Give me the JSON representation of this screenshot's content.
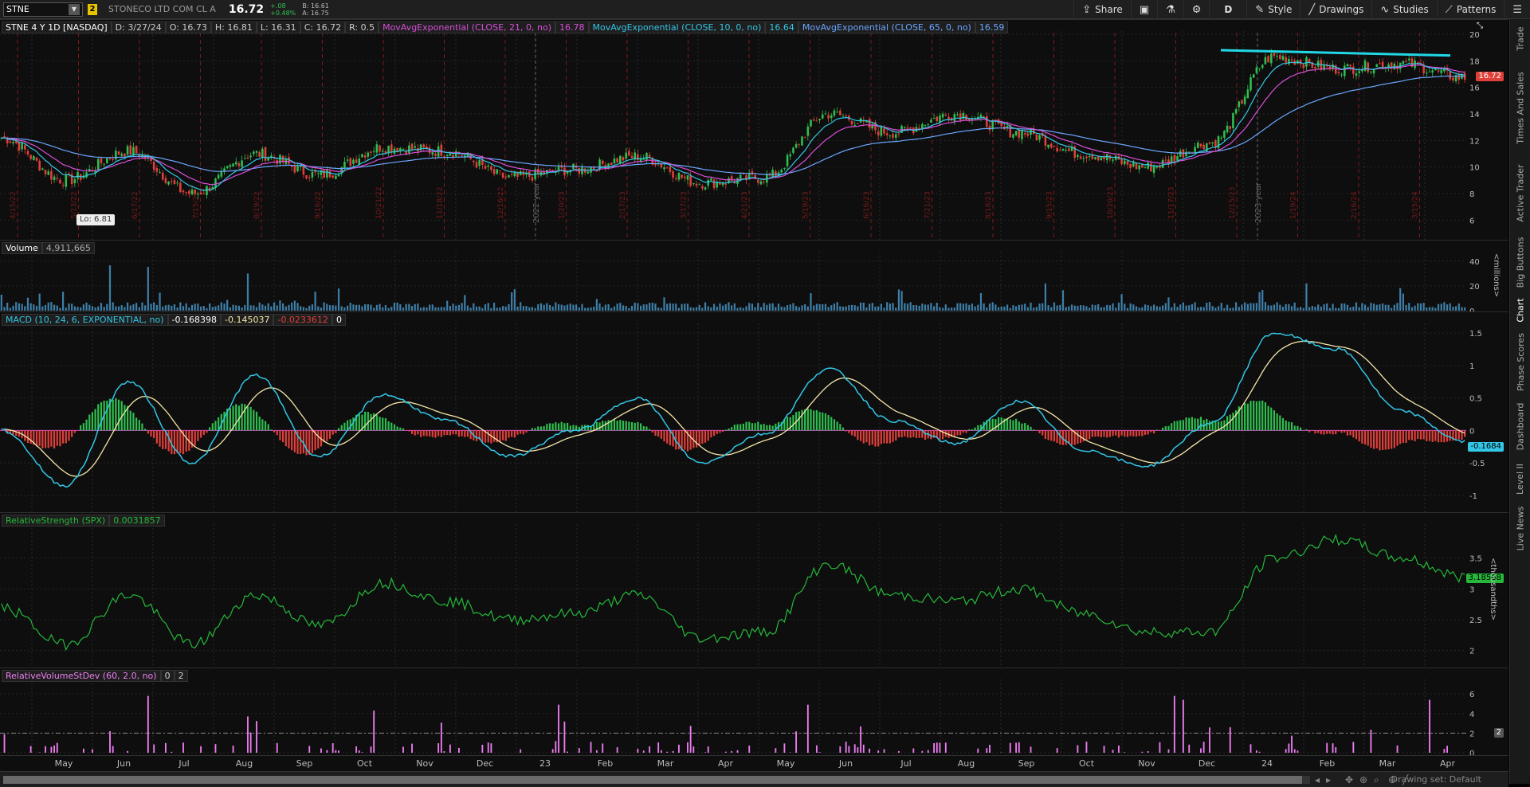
{
  "toolbar": {
    "symbol": "STNE",
    "link_badge": "2",
    "company": "STONECO LTD COM CL A",
    "last": "16.72",
    "change": "+.08",
    "change_pct": "+0.48%",
    "bid": "B: 16.61",
    "ask": "A: 16.75",
    "buttons": [
      {
        "label": "Share",
        "icon": "share-icon"
      },
      {
        "label": "",
        "icon": "camera-icon"
      },
      {
        "label": "",
        "icon": "flask-icon"
      },
      {
        "label": "",
        "icon": "gear-icon"
      },
      {
        "label": "D",
        "icon": ""
      },
      {
        "label": "Style",
        "icon": "style-icon"
      },
      {
        "label": "Drawings",
        "icon": "pencil-icon"
      },
      {
        "label": "Studies",
        "icon": "studies-icon"
      },
      {
        "label": "Patterns",
        "icon": "patterns-icon"
      }
    ]
  },
  "side_tabs": [
    "Trade",
    "Times And Sales",
    "Active Trader",
    "Big Buttons",
    "Chart",
    "Phase Scores",
    "Dashboard",
    "Level II",
    "Live News"
  ],
  "price_panel": {
    "title": "STNE 4 Y 1D [NASDAQ]",
    "date": "D: 3/27/24",
    "open": "O: 16.73",
    "high": "H: 16.81",
    "low": "L: 16.31",
    "close": "C: 16.72",
    "range": "R: 0.5",
    "ema21_label": "MovAvgExponential (CLOSE, 21, 0, no)",
    "ema21_value": "16.78",
    "ema10_label": "MovAvgExponential (CLOSE, 10, 0, no)",
    "ema10_value": "16.64",
    "ema65_label": "MovAvgExponential (CLOSE, 65, 0, no)",
    "ema65_value": "16.59",
    "low_bubble": "Lo: 6.81",
    "last_tag": "16.72",
    "y_ticks": [
      "20",
      "18",
      "16",
      "14",
      "12",
      "10",
      "8",
      "6"
    ],
    "year_markers": [
      "2022 year",
      "2023 year"
    ],
    "date_markers": [
      "4/15/22",
      "5/13/22",
      "6/17/22",
      "7/15/22",
      "8/19/22",
      "9/16/22",
      "10/21/22",
      "11/18/22",
      "12/16/22",
      "1/20/23",
      "2/17/23",
      "3/17/23",
      "4/21/23",
      "5/19/23",
      "6/16/23",
      "7/21/23",
      "8/18/23",
      "9/15/23",
      "10/20/23",
      "11/17/23",
      "12/15/23",
      "1/19/24",
      "2/16/24",
      "3/15/24"
    ]
  },
  "volume_panel": {
    "title": "Volume",
    "value": "4,911,665",
    "y_ticks": [
      "40",
      "20",
      "0"
    ],
    "unit": "<millions>"
  },
  "macd_panel": {
    "title": "MACD (10, 24, 6, EXPONENTIAL, no)",
    "value": "-0.168398",
    "avg": "-0.145037",
    "diff": "-0.0233612",
    "zero": "0",
    "y_ticks": [
      "1.5",
      "1",
      "0.5",
      "0",
      "-0.5",
      "-1"
    ],
    "last_tag": "-0.1684"
  },
  "rs_panel": {
    "title": "RelativeStrength (SPX)",
    "value": "0.0031857",
    "y_ticks": [
      "3.5",
      "3",
      "2.5",
      "2"
    ],
    "unit": "<thousandths>",
    "last_tag": "3.18568"
  },
  "rv_panel": {
    "title": "RelativeVolumeStDev (60, 2.0, no)",
    "v1": "0",
    "v2": "2",
    "y_ticks": [
      "6",
      "4",
      "2",
      "0"
    ],
    "tag": "2"
  },
  "x_axis": [
    "May",
    "Jun",
    "Jul",
    "Aug",
    "Sep",
    "Oct",
    "Nov",
    "Dec",
    "23",
    "Feb",
    "Mar",
    "Apr",
    "May",
    "Jun",
    "Jul",
    "Aug",
    "Sep",
    "Oct",
    "Nov",
    "Dec",
    "24",
    "Feb",
    "Mar",
    "Apr"
  ],
  "status": {
    "drawing_set": "Drawing set: Default"
  },
  "colors": {
    "up": "#2fbf4f",
    "down": "#e0403a",
    "ema10": "#33c6e6",
    "ema21": "#d94fd9",
    "ema65": "#6aa6ff",
    "macd": "#33c6e6",
    "signal": "#f5e6a8",
    "rs": "#25b83a",
    "rv": "#ee7df2",
    "trendline": "#22d7e6"
  },
  "chart_data": {
    "type": "line",
    "ticker": "STNE",
    "price_series": {
      "name": "STNE 4 Y 1D [NASDAQ]",
      "x": [
        "Apr-22",
        "May-22",
        "Jun-22",
        "Jul-22",
        "Aug-22",
        "Sep-22",
        "Oct-22",
        "Nov-22",
        "Dec-22",
        "Jan-23",
        "Feb-23",
        "Mar-23",
        "Apr-23",
        "May-23",
        "Jun-23",
        "Jul-23",
        "Aug-23",
        "Sep-23",
        "Oct-23",
        "Nov-23",
        "Dec-23",
        "Jan-24",
        "Feb-24",
        "Mar-24"
      ],
      "close": [
        12.2,
        9.0,
        11.2,
        8.0,
        11.0,
        9.4,
        11.5,
        11.2,
        9.2,
        9.8,
        10.8,
        8.8,
        9.2,
        14.0,
        12.6,
        14.0,
        12.6,
        11.0,
        10.0,
        11.8,
        18.3,
        17.4,
        17.8,
        16.72
      ],
      "ylim": [
        5,
        20
      ]
    },
    "volume_millions": {
      "ylim": [
        0,
        45
      ]
    },
    "macd": {
      "values": [
        0.0,
        -0.85,
        0.75,
        -0.5,
        0.85,
        -0.4,
        0.55,
        0.15,
        -0.4,
        0.0,
        0.5,
        -0.5,
        -0.05,
        0.95,
        0.15,
        -0.2,
        0.45,
        -0.3,
        -0.55,
        0.1,
        1.5,
        1.25,
        0.3,
        -0.17
      ],
      "ylim": [
        -1.1,
        1.6
      ]
    },
    "relative_strength": {
      "values": [
        2.7,
        2.1,
        2.9,
        2.1,
        2.9,
        2.4,
        3.1,
        2.8,
        2.5,
        2.6,
        2.9,
        2.2,
        2.3,
        3.4,
        2.9,
        2.8,
        3.0,
        2.6,
        2.3,
        2.3,
        3.5,
        3.8,
        3.5,
        3.19
      ],
      "ylim": [
        1.8,
        4.0
      ]
    },
    "relative_volume_stdev": {
      "ylim": [
        0,
        6.5
      ],
      "threshold": 2
    }
  }
}
